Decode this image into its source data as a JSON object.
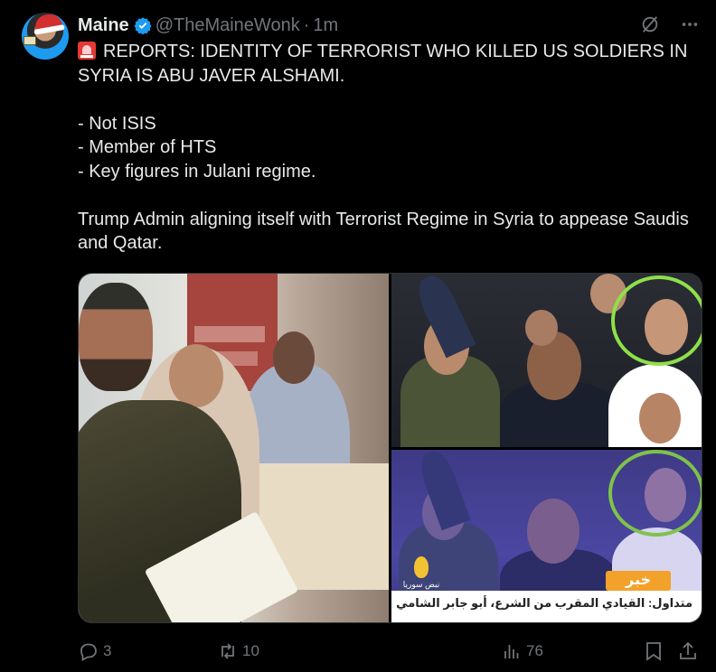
{
  "author": {
    "name": "Maine",
    "handle": "@TheMaineWonk",
    "separator": "·",
    "time": "1m"
  },
  "tweet": {
    "lines": [
      "REPORTS: IDENTITY OF TERRORIST WHO KILLED US SOLDIERS IN SYRIA  IS ABU JAVER ALSHAMI.",
      "",
      "- Not ISIS",
      "- Member of  HTS",
      "- Key figures in Julani regime.",
      "",
      "Trump Admin aligning itself with Terrorist Regime in Syria to appease Saudis and Qatar."
    ]
  },
  "media": {
    "news_tag": "خبر",
    "caption": "متداول: القيادي المقرب من الشرع، أبو جابر الشامي",
    "logo_text": "نبض سوريا"
  },
  "actions": {
    "replies": "3",
    "reposts": "10",
    "views": "76"
  },
  "icons": {
    "verified": "verified-badge-icon",
    "grok": "grok-icon",
    "more": "more-icon",
    "reply": "reply-icon",
    "repost": "repost-icon",
    "views": "views-icon",
    "bookmark": "bookmark-icon",
    "share": "share-icon"
  },
  "colors": {
    "background": "#000000",
    "text": "#e7e9ea",
    "muted": "#71767b",
    "verified": "#1d9bf0",
    "highlight_circle": "#8ee04a",
    "news_tag": "#f2a22a"
  }
}
